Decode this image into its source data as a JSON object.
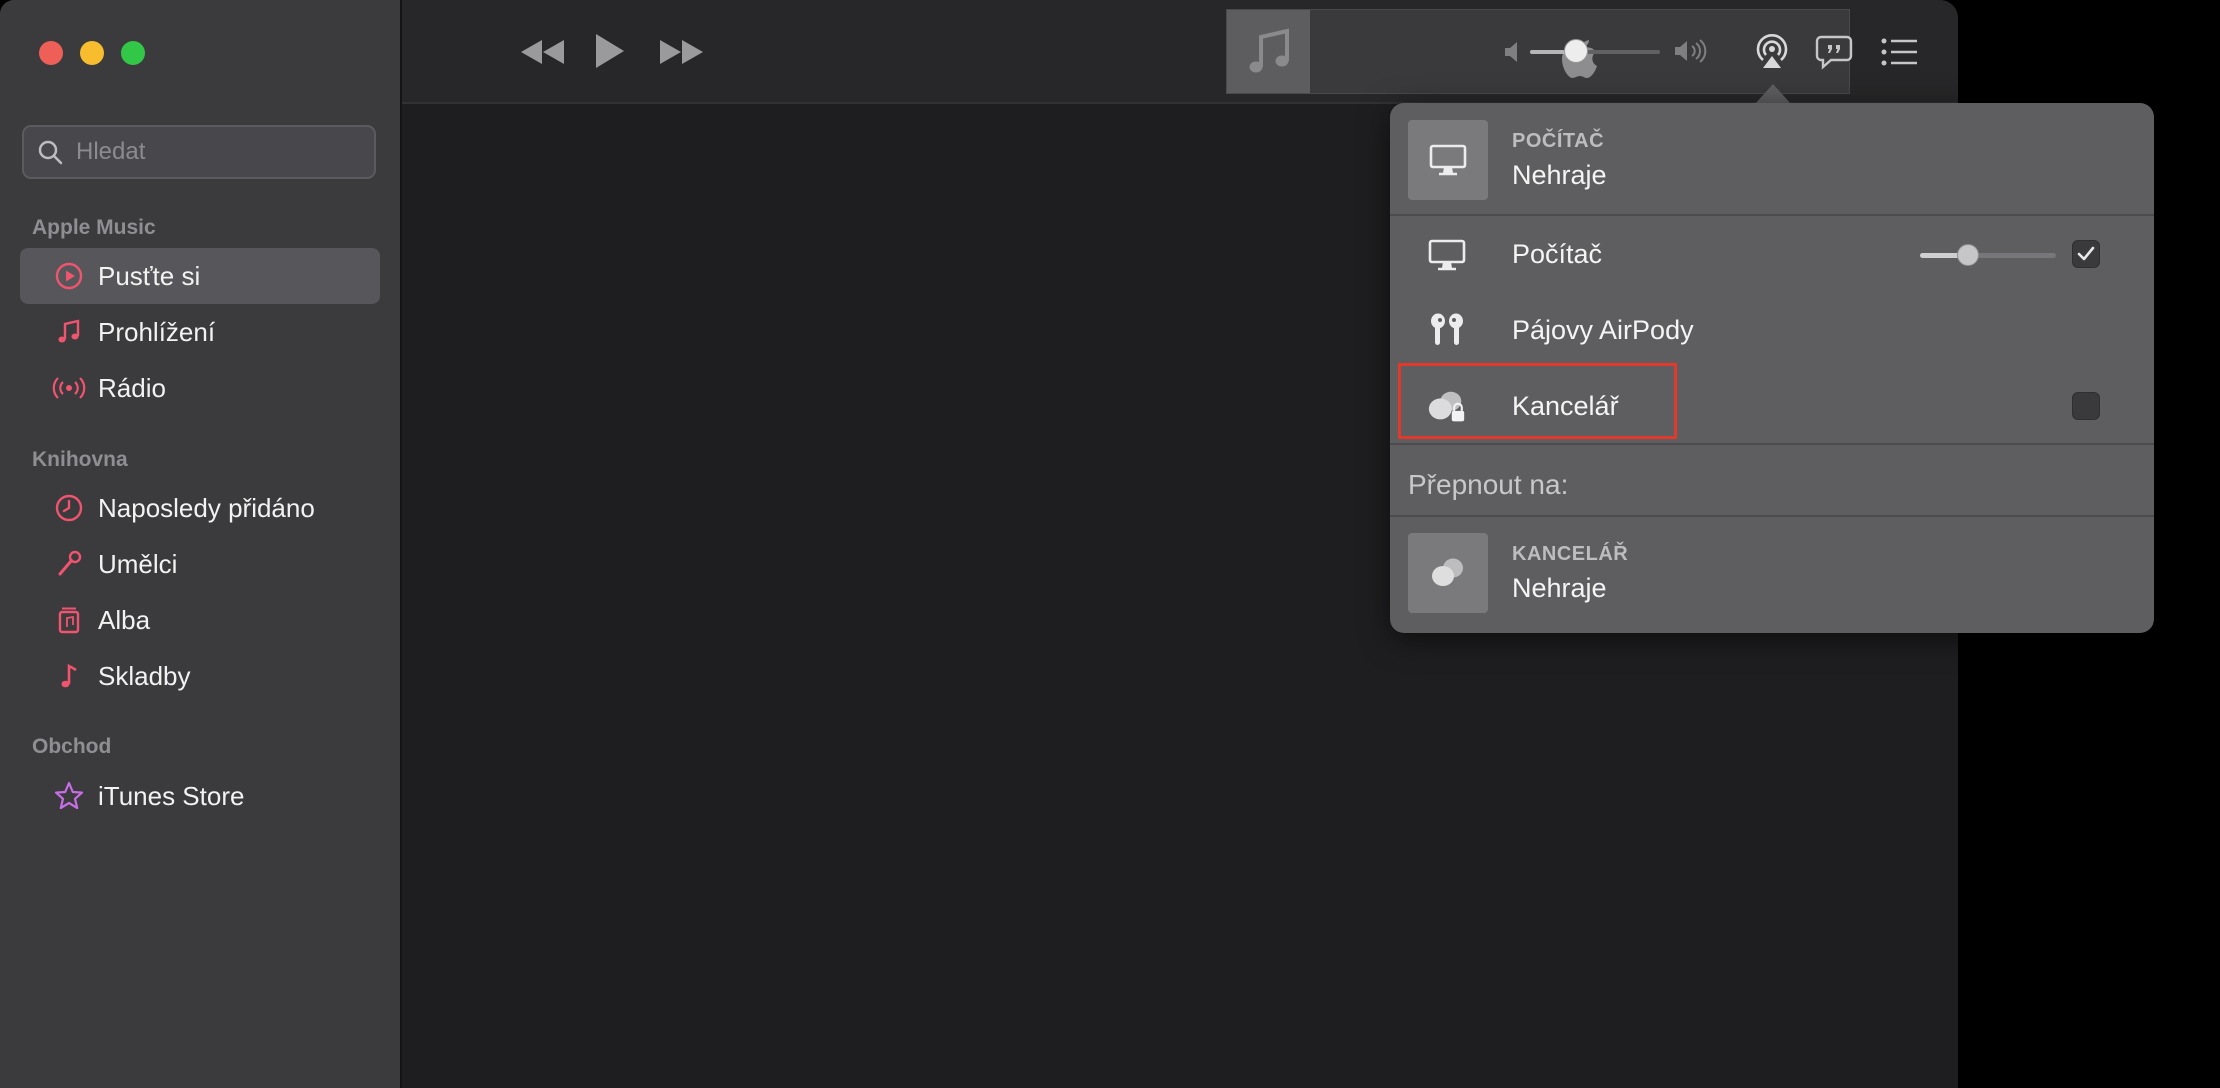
{
  "search": {
    "placeholder": "Hledat"
  },
  "sidebar": {
    "sections": [
      {
        "label": "Apple Music"
      },
      {
        "label": "Knihovna"
      },
      {
        "label": "Obchod"
      }
    ],
    "items": [
      {
        "label": "Pusťte si",
        "icon": "play-circle-icon",
        "selected": true
      },
      {
        "label": "Prohlížení",
        "icon": "music-note-icon"
      },
      {
        "label": "Rádio",
        "icon": "radio-waves-icon"
      },
      {
        "label": "Naposledy přidáno",
        "icon": "clock-icon"
      },
      {
        "label": "Umělci",
        "icon": "microphone-icon"
      },
      {
        "label": "Alba",
        "icon": "album-icon"
      },
      {
        "label": "Skladby",
        "icon": "music-note-icon"
      },
      {
        "label": "iTunes Store",
        "icon": "star-icon"
      }
    ]
  },
  "toolbar": {
    "icons": [
      "rewind-icon",
      "play-icon",
      "fast-forward-icon",
      "volume-low-icon",
      "volume-high-icon",
      "airplay-icon",
      "lyrics-icon",
      "queue-list-icon"
    ],
    "volume_level": 0.35
  },
  "airplay": {
    "now_playing": {
      "label": "POČÍTAČ",
      "status": "Nehraje"
    },
    "devices": [
      {
        "name": "Počítač",
        "icon": "computer-icon",
        "checked": true,
        "volume_level": 0.35
      },
      {
        "name": "Pájovy AirPody",
        "icon": "airpods-icon"
      },
      {
        "name": "Kancelář",
        "icon": "homepod-lock-icon",
        "checked": false
      }
    ],
    "switch_to_label": "Přepnout na:",
    "switch_target": {
      "label": "KANCELÁŘ",
      "status": "Nehraje"
    }
  },
  "colors": {
    "accent_icon": "#f0546e",
    "store_icon": "#c86de6",
    "highlight": "#e13a2c"
  }
}
